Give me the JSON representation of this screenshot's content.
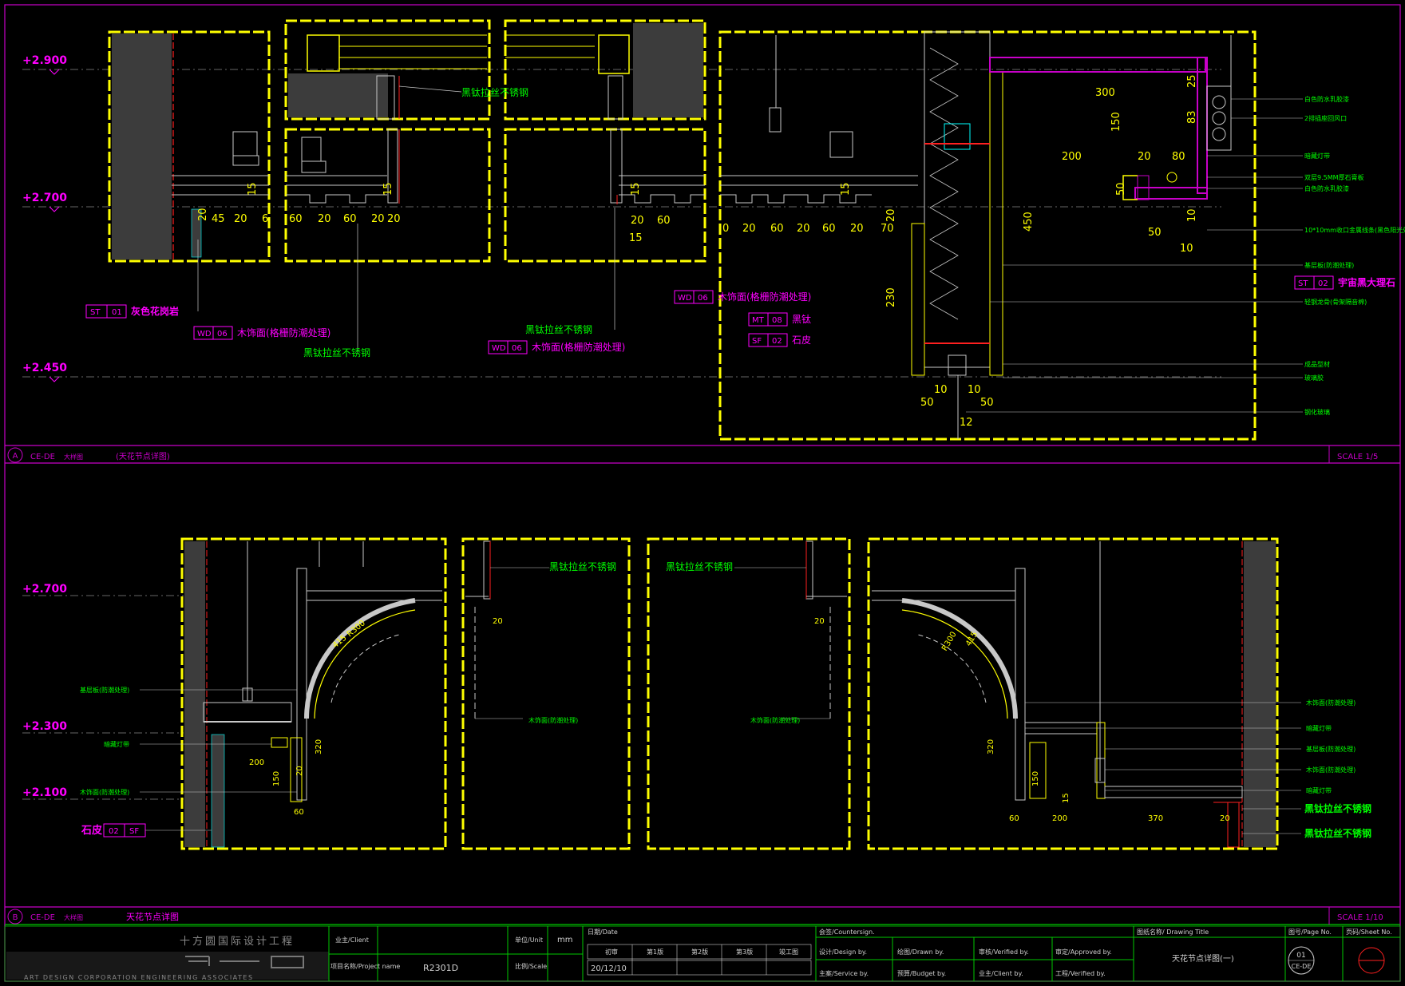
{
  "colors": {
    "background": "#000000",
    "frame": "#c800c8",
    "detail_box": "#ffff00",
    "level": "#ff00ff",
    "note": "#00ff00",
    "dimension": "#ffff00",
    "wall_fill": "#3c3c3c",
    "outline": "#c8c8c8",
    "leader": "#ff2020",
    "titleblock": "#d0d0d0"
  },
  "section_a": {
    "index": "A",
    "ref": "CE-DE",
    "ref_sub": "大样图",
    "title": "(天花节点详图)",
    "scale": "SCALE 1/5",
    "levels": [
      "+2.900",
      "+2.700",
      "+2.450"
    ],
    "notes": [
      "黑钛拉丝不锈钢",
      "黑钛拉丝不锈钢",
      "黑钛拉丝不锈钢"
    ],
    "tags": [
      {
        "code": "ST",
        "num": "01",
        "text": "灰色花岗岩"
      },
      {
        "code": "WD",
        "num": "06",
        "text": "木饰面(格栅防潮处理)"
      },
      {
        "code": "WD",
        "num": "06",
        "text": "木饰面(格栅防潮处理)"
      },
      {
        "code": "WD",
        "num": "06",
        "text": "木饰面(格栅防潮处理)"
      },
      {
        "code": "MT",
        "num": "08",
        "text": "黑钛"
      },
      {
        "code": "SF",
        "num": "02",
        "text": "石皮"
      },
      {
        "code": "ST",
        "num": "02",
        "text": "宇宙黑大理石"
      }
    ],
    "right_notes": [
      "白色防水乳胶漆",
      "2排插座回风口",
      "暗藏灯带",
      "双层9.5MM厚石膏板",
      "白色防水乳胶漆",
      "10*10mm收口金属线条(黑色阳光处)",
      "基层板(防潮处理)",
      "轻钢龙骨(骨架隔音棉)",
      "成品型材",
      "玻璃胶",
      "钢化玻璃"
    ],
    "dims": {
      "d1": [
        "15",
        "20",
        "45",
        "20",
        "6"
      ],
      "d2": [
        "60",
        "20",
        "60",
        "20",
        "20",
        "15"
      ],
      "d3": [
        "15",
        "20",
        "60",
        "15"
      ],
      "d4": [
        "0",
        "20",
        "60",
        "20",
        "60",
        "20",
        "70",
        "15",
        "20",
        "230"
      ],
      "d5": [
        "300",
        "150",
        "200",
        "20",
        "80",
        "25",
        "83",
        "50",
        "10",
        "50",
        "10",
        "450",
        "10",
        "10",
        "50",
        "50",
        "12"
      ]
    }
  },
  "section_b": {
    "index": "B",
    "ref": "CE-DE",
    "ref_sub": "大样图",
    "title": "天花节点详图",
    "scale": "SCALE 1/10",
    "levels": [
      "+2.700",
      "+2.300",
      "+2.100"
    ],
    "left_notes": [
      "基层板(防潮处理)",
      "暗藏灯带",
      "木饰面(防潮处理)"
    ],
    "tag": {
      "text": "石皮",
      "num": "02",
      "code": "SF"
    },
    "notes": [
      "黑钛拉丝不锈钢",
      "黑钛拉丝不锈钢"
    ],
    "mid_notes": [
      "木饰面(防潮处理)",
      "木饰面(防潮处理)"
    ],
    "right_notes": [
      "木饰面(防潮处理)",
      "暗藏灯带",
      "基层板(防潮处理)",
      "木饰面(防潮处理)",
      "暗藏灯带"
    ],
    "right_tags": [
      "黑钛拉丝不锈钢",
      "黑钛拉丝不锈钢"
    ],
    "dims": {
      "left": [
        "415",
        "R300",
        "320",
        "200",
        "150",
        "60",
        "20"
      ],
      "mid1": [
        "20"
      ],
      "mid2": [
        "20"
      ],
      "right": [
        "R300",
        "415",
        "320",
        "150",
        "15",
        "60",
        "200",
        "370",
        "20"
      ]
    }
  },
  "titleblock": {
    "company_cn": "十方圆国际设计工程",
    "company_en": "ART DESIGN CORPORATION ENGINEERING ASSOCIATES",
    "client_label": "业主/Client",
    "project_label": "项目名称/Project name",
    "project_value": "R2301D",
    "unit_label": "单位/Unit",
    "unit_value": "mm",
    "scale_label": "比例/Scale",
    "date_label": "日期/Date",
    "stages": [
      "初审",
      "第1版",
      "第2版",
      "第3版",
      "竣工图"
    ],
    "date_value": "20/12/10",
    "countersign": "会签/Countersign.",
    "design_by": "设计/Design by.",
    "service_by": "主案/Service by.",
    "drawn_by": "绘图/Drawn by.",
    "budget_by": "预算/Budget by.",
    "verified_by": "审核/Verified by.",
    "client_by": "业主/Client by.",
    "approved_by": "审定/Approved by.",
    "verified2_by": "工程/Verified by.",
    "drawing_title_label": "图纸名称/ Drawing Title",
    "drawing_title": "天花节点详图(一)",
    "page_label": "图号/Page No.",
    "page_no": "01",
    "page_ref": "CE-DE",
    "sheet_label": "页码/Sheet No."
  }
}
